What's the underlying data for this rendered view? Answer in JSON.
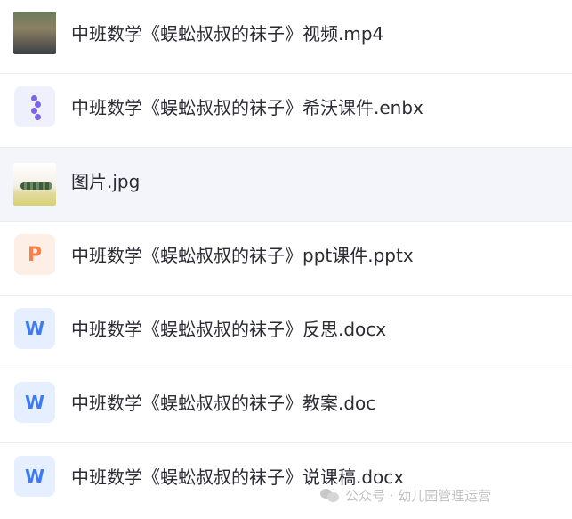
{
  "files": [
    {
      "name": "中班数学《蜈蚣叔叔的袜子》视频.mp4",
      "icon": "video-thumbnail-icon",
      "highlighted": false
    },
    {
      "name": "中班数学《蜈蚣叔叔的袜子》希沃课件.enbx",
      "icon": "enbx-icon",
      "highlighted": false
    },
    {
      "name": "图片.jpg",
      "icon": "image-thumbnail-icon",
      "highlighted": true
    },
    {
      "name": "中班数学《蜈蚣叔叔的袜子》ppt课件.pptx",
      "icon": "ppt-icon",
      "icon_letter": "P",
      "highlighted": false
    },
    {
      "name": "中班数学《蜈蚣叔叔的袜子》反思.docx",
      "icon": "word-icon",
      "icon_letter": "W",
      "highlighted": false
    },
    {
      "name": "中班数学《蜈蚣叔叔的袜子》教案.doc",
      "icon": "word-icon",
      "icon_letter": "W",
      "highlighted": false
    },
    {
      "name": "中班数学《蜈蚣叔叔的袜子》说课稿.docx",
      "icon": "word-icon",
      "icon_letter": "W",
      "highlighted": false
    }
  ],
  "watermark": {
    "text": "公众号 · 幼儿园管理运营",
    "icon": "wechat-official-account-icon"
  },
  "colors": {
    "highlight_row": "#f4f5fb",
    "enbx_accent": "#7b64e6",
    "ppt_accent": "#f4804a",
    "word_accent": "#3e7bf2"
  }
}
